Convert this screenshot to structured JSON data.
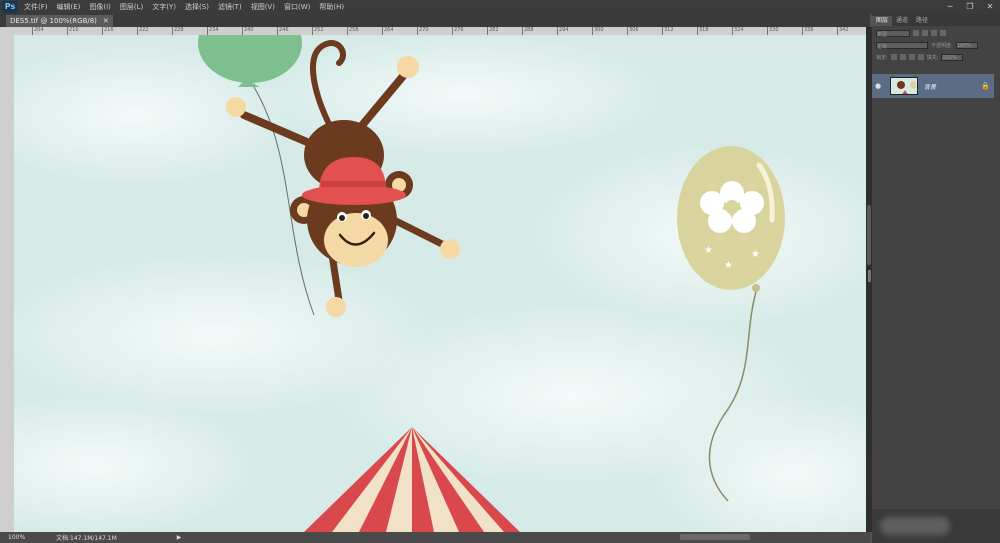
{
  "app": {
    "logo": "Ps"
  },
  "menu": [
    "文件(F)",
    "编辑(E)",
    "图像(I)",
    "图层(L)",
    "文字(Y)",
    "选择(S)",
    "滤镜(T)",
    "视图(V)",
    "窗口(W)",
    "帮助(H)"
  ],
  "window_controls": {
    "minimize": "─",
    "restore": "❐",
    "close": "✕"
  },
  "document_tab": {
    "title": "DES5.tif @ 100%(RGB/8)",
    "close": "✕"
  },
  "ruler_top_ticks": [
    "204",
    "210",
    "216",
    "222",
    "228",
    "234",
    "240",
    "246",
    "252",
    "258",
    "264",
    "270",
    "276",
    "282",
    "288",
    "294",
    "300",
    "306",
    "312",
    "318",
    "324",
    "330",
    "336",
    "342"
  ],
  "status": {
    "zoom": "100%",
    "doc": "文档:147.1M/147.1M",
    "arrow": "▶"
  },
  "panel": {
    "tabs": [
      "图层",
      "通道",
      "路径"
    ],
    "filter_label": "类型",
    "blend_mode": "正常",
    "opacity_label": "不透明度:",
    "opacity_value": "100%",
    "lock_label": "锁定:",
    "fill_label": "填充:",
    "fill_value": "100%",
    "layer": {
      "name": "背景",
      "visibility_icon": "●",
      "lock_icon": "🔒"
    }
  },
  "colors": {
    "sky": "#d9ecea",
    "monkey_brown": "#6b3a1f",
    "hat_red": "#e2504f",
    "balloon_green": "#7dbf8e",
    "balloon_khaki": "#d9d49d",
    "tent_red": "#d9484d",
    "tent_cream": "#f1e1c6",
    "layer_selected": "#5b6c84"
  }
}
